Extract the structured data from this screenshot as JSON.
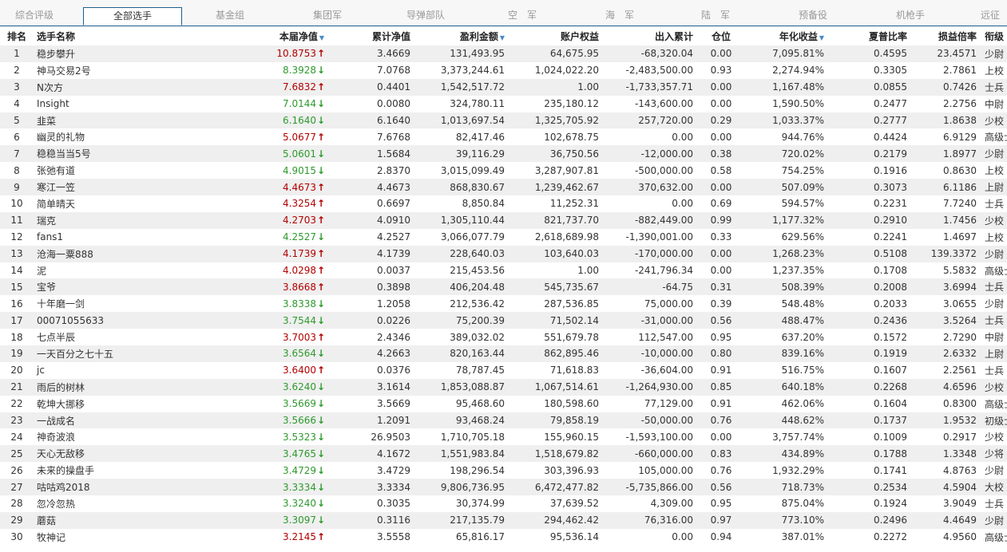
{
  "tabs": [
    "综合评级",
    "全部选手",
    "基金组",
    "集团军",
    "导弹部队",
    "空　军",
    "海　军",
    "陆　军",
    "预备役",
    "机枪手",
    "远征"
  ],
  "active_tab": 1,
  "columns": [
    "排名",
    "选手名称",
    "本届净值",
    "累计净值",
    "盈利金额",
    "账户权益",
    "出入累计",
    "仓位",
    "年化收益",
    "夏普比率",
    "损益倍率",
    "衔级"
  ],
  "sorted_columns": [
    "本届净值",
    "盈利金额",
    "年化收益"
  ],
  "colors": {
    "up": "#b20000",
    "down": "#2d9a2d",
    "stripe": "#efefef"
  },
  "rows": [
    {
      "rank": "1",
      "name": "稳步攀升",
      "nav": "10.8753",
      "trend": "up",
      "cum": "3.4669",
      "profit": "131,493.95",
      "equity": "64,675.95",
      "inout": "-68,320.04",
      "pos": "0.00",
      "annual": "7,095.81%",
      "sharpe": "0.4595",
      "ratio": "23.4571",
      "grade": "少尉"
    },
    {
      "rank": "2",
      "name": "神马交易2号",
      "nav": "8.3928",
      "trend": "down",
      "cum": "7.0768",
      "profit": "3,373,244.61",
      "equity": "1,024,022.20",
      "inout": "-2,483,500.00",
      "pos": "0.93",
      "annual": "2,274.94%",
      "sharpe": "0.3305",
      "ratio": "2.7861",
      "grade": "上校"
    },
    {
      "rank": "3",
      "name": "N次方",
      "nav": "7.6832",
      "trend": "up",
      "cum": "0.4401",
      "profit": "1,542,517.72",
      "equity": "1.00",
      "inout": "-1,733,357.71",
      "pos": "0.00",
      "annual": "1,167.48%",
      "sharpe": "0.0855",
      "ratio": "0.7426",
      "grade": "士兵"
    },
    {
      "rank": "4",
      "name": "Insight",
      "nav": "7.0144",
      "trend": "down",
      "cum": "0.0080",
      "profit": "324,780.11",
      "equity": "235,180.12",
      "inout": "-143,600.00",
      "pos": "0.00",
      "annual": "1,590.50%",
      "sharpe": "0.2477",
      "ratio": "2.2756",
      "grade": "中尉"
    },
    {
      "rank": "5",
      "name": "韭菜",
      "nav": "6.1640",
      "trend": "down",
      "cum": "6.1640",
      "profit": "1,013,697.54",
      "equity": "1,325,705.92",
      "inout": "257,720.00",
      "pos": "0.29",
      "annual": "1,033.37%",
      "sharpe": "0.2777",
      "ratio": "1.8638",
      "grade": "少校"
    },
    {
      "rank": "6",
      "name": "幽灵的礼物",
      "nav": "5.0677",
      "trend": "up",
      "cum": "7.6768",
      "profit": "82,417.46",
      "equity": "102,678.75",
      "inout": "0.00",
      "pos": "0.00",
      "annual": "944.76%",
      "sharpe": "0.4424",
      "ratio": "6.9129",
      "grade": "高级士官"
    },
    {
      "rank": "7",
      "name": "稳稳当当5号",
      "nav": "5.0601",
      "trend": "down",
      "cum": "1.5684",
      "profit": "39,116.29",
      "equity": "36,750.56",
      "inout": "-12,000.00",
      "pos": "0.38",
      "annual": "720.02%",
      "sharpe": "0.2179",
      "ratio": "1.8977",
      "grade": "少尉"
    },
    {
      "rank": "8",
      "name": "张弛有道",
      "nav": "4.9015",
      "trend": "down",
      "cum": "2.8370",
      "profit": "3,015,099.49",
      "equity": "3,287,907.81",
      "inout": "-500,000.00",
      "pos": "0.58",
      "annual": "754.25%",
      "sharpe": "0.1916",
      "ratio": "0.8630",
      "grade": "上校"
    },
    {
      "rank": "9",
      "name": "寒江一笠",
      "nav": "4.4673",
      "trend": "up",
      "cum": "4.4673",
      "profit": "868,830.67",
      "equity": "1,239,462.67",
      "inout": "370,632.00",
      "pos": "0.00",
      "annual": "507.09%",
      "sharpe": "0.3073",
      "ratio": "6.1186",
      "grade": "上尉"
    },
    {
      "rank": "10",
      "name": "简单晴天",
      "nav": "4.3254",
      "trend": "up",
      "cum": "0.6697",
      "profit": "8,850.84",
      "equity": "11,252.31",
      "inout": "0.00",
      "pos": "0.69",
      "annual": "594.57%",
      "sharpe": "0.2231",
      "ratio": "7.7240",
      "grade": "士兵"
    },
    {
      "rank": "11",
      "name": "瑞克",
      "nav": "4.2703",
      "trend": "up",
      "cum": "4.0910",
      "profit": "1,305,110.44",
      "equity": "821,737.70",
      "inout": "-882,449.00",
      "pos": "0.99",
      "annual": "1,177.32%",
      "sharpe": "0.2910",
      "ratio": "1.7456",
      "grade": "少校"
    },
    {
      "rank": "12",
      "name": "fans1",
      "nav": "4.2527",
      "trend": "down",
      "cum": "4.2527",
      "profit": "3,066,077.79",
      "equity": "2,618,689.98",
      "inout": "-1,390,001.00",
      "pos": "0.33",
      "annual": "629.56%",
      "sharpe": "0.2241",
      "ratio": "1.4697",
      "grade": "上校"
    },
    {
      "rank": "13",
      "name": "沧海一粟888",
      "nav": "4.1739",
      "trend": "up",
      "cum": "4.1739",
      "profit": "228,640.03",
      "equity": "103,640.03",
      "inout": "-170,000.00",
      "pos": "0.00",
      "annual": "1,268.23%",
      "sharpe": "0.5108",
      "ratio": "139.3372",
      "grade": "少尉"
    },
    {
      "rank": "14",
      "name": "泥",
      "nav": "4.0298",
      "trend": "up",
      "cum": "0.0037",
      "profit": "215,453.56",
      "equity": "1.00",
      "inout": "-241,796.34",
      "pos": "0.00",
      "annual": "1,237.35%",
      "sharpe": "0.1708",
      "ratio": "5.5832",
      "grade": "高级士官"
    },
    {
      "rank": "15",
      "name": "宝爷",
      "nav": "3.8668",
      "trend": "up",
      "cum": "0.3898",
      "profit": "406,204.48",
      "equity": "545,735.67",
      "inout": "-64.75",
      "pos": "0.31",
      "annual": "508.39%",
      "sharpe": "0.2008",
      "ratio": "3.6994",
      "grade": "士兵"
    },
    {
      "rank": "16",
      "name": "十年磨一剑",
      "nav": "3.8338",
      "trend": "down",
      "cum": "1.2058",
      "profit": "212,536.42",
      "equity": "287,536.85",
      "inout": "75,000.00",
      "pos": "0.39",
      "annual": "548.48%",
      "sharpe": "0.2033",
      "ratio": "3.0655",
      "grade": "少尉"
    },
    {
      "rank": "17",
      "name": "00071055633",
      "nav": "3.7544",
      "trend": "down",
      "cum": "0.0226",
      "profit": "75,200.39",
      "equity": "71,502.14",
      "inout": "-31,000.00",
      "pos": "0.56",
      "annual": "488.47%",
      "sharpe": "0.2436",
      "ratio": "3.5264",
      "grade": "士兵"
    },
    {
      "rank": "18",
      "name": "七点半辰",
      "nav": "3.7003",
      "trend": "up",
      "cum": "2.4346",
      "profit": "389,032.02",
      "equity": "551,679.78",
      "inout": "112,547.00",
      "pos": "0.95",
      "annual": "637.20%",
      "sharpe": "0.1572",
      "ratio": "2.7290",
      "grade": "中尉"
    },
    {
      "rank": "19",
      "name": "一天百分之七十五",
      "nav": "3.6564",
      "trend": "down",
      "cum": "4.2663",
      "profit": "820,163.44",
      "equity": "862,895.46",
      "inout": "-10,000.00",
      "pos": "0.80",
      "annual": "839.16%",
      "sharpe": "0.1919",
      "ratio": "2.6332",
      "grade": "上尉"
    },
    {
      "rank": "20",
      "name": "jc",
      "nav": "3.6400",
      "trend": "up",
      "cum": "0.0376",
      "profit": "78,787.45",
      "equity": "71,618.83",
      "inout": "-36,604.00",
      "pos": "0.91",
      "annual": "516.75%",
      "sharpe": "0.1607",
      "ratio": "2.2561",
      "grade": "士兵"
    },
    {
      "rank": "21",
      "name": "雨后的树林",
      "nav": "3.6240",
      "trend": "down",
      "cum": "3.1614",
      "profit": "1,853,088.87",
      "equity": "1,067,514.61",
      "inout": "-1,264,930.00",
      "pos": "0.85",
      "annual": "640.18%",
      "sharpe": "0.2268",
      "ratio": "4.6596",
      "grade": "少校"
    },
    {
      "rank": "22",
      "name": "乾坤大挪移",
      "nav": "3.5669",
      "trend": "down",
      "cum": "3.5669",
      "profit": "95,468.60",
      "equity": "180,598.60",
      "inout": "77,129.00",
      "pos": "0.91",
      "annual": "462.06%",
      "sharpe": "0.1604",
      "ratio": "0.8300",
      "grade": "高级士官"
    },
    {
      "rank": "23",
      "name": "一战成名",
      "nav": "3.5666",
      "trend": "down",
      "cum": "1.2091",
      "profit": "93,468.24",
      "equity": "79,858.19",
      "inout": "-50,000.00",
      "pos": "0.76",
      "annual": "448.62%",
      "sharpe": "0.1737",
      "ratio": "1.9532",
      "grade": "初级士官"
    },
    {
      "rank": "24",
      "name": "神奇波浪",
      "nav": "3.5323",
      "trend": "down",
      "cum": "26.9503",
      "profit": "1,710,705.18",
      "equity": "155,960.15",
      "inout": "-1,593,100.00",
      "pos": "0.00",
      "annual": "3,757.74%",
      "sharpe": "0.1009",
      "ratio": "0.2917",
      "grade": "少校"
    },
    {
      "rank": "25",
      "name": "天心无敌移",
      "nav": "3.4765",
      "trend": "down",
      "cum": "4.1672",
      "profit": "1,551,983.84",
      "equity": "1,518,679.82",
      "inout": "-660,000.00",
      "pos": "0.83",
      "annual": "434.89%",
      "sharpe": "0.1788",
      "ratio": "1.3348",
      "grade": "少将"
    },
    {
      "rank": "26",
      "name": "未来的操盘手",
      "nav": "3.4729",
      "trend": "down",
      "cum": "3.4729",
      "profit": "198,296.54",
      "equity": "303,396.93",
      "inout": "105,000.00",
      "pos": "0.76",
      "annual": "1,932.29%",
      "sharpe": "0.1741",
      "ratio": "4.8763",
      "grade": "少尉"
    },
    {
      "rank": "27",
      "name": "咕咕鸡2018",
      "nav": "3.3334",
      "trend": "down",
      "cum": "3.3334",
      "profit": "9,806,736.95",
      "equity": "6,472,477.82",
      "inout": "-5,735,866.00",
      "pos": "0.56",
      "annual": "718.73%",
      "sharpe": "0.2534",
      "ratio": "4.5904",
      "grade": "大校"
    },
    {
      "rank": "28",
      "name": "忽冷忽热",
      "nav": "3.3240",
      "trend": "down",
      "cum": "0.3035",
      "profit": "30,374.99",
      "equity": "37,639.52",
      "inout": "4,309.00",
      "pos": "0.95",
      "annual": "875.04%",
      "sharpe": "0.1924",
      "ratio": "3.9049",
      "grade": "士兵"
    },
    {
      "rank": "29",
      "name": "蘑菇",
      "nav": "3.3097",
      "trend": "down",
      "cum": "0.3116",
      "profit": "217,135.79",
      "equity": "294,462.42",
      "inout": "76,316.00",
      "pos": "0.97",
      "annual": "773.10%",
      "sharpe": "0.2496",
      "ratio": "4.4649",
      "grade": "少尉"
    },
    {
      "rank": "30",
      "name": "牧神记",
      "nav": "3.2145",
      "trend": "up",
      "cum": "3.5558",
      "profit": "65,816.17",
      "equity": "95,536.14",
      "inout": "0.00",
      "pos": "0.94",
      "annual": "387.01%",
      "sharpe": "0.2272",
      "ratio": "4.9560",
      "grade": "高级士官"
    }
  ]
}
